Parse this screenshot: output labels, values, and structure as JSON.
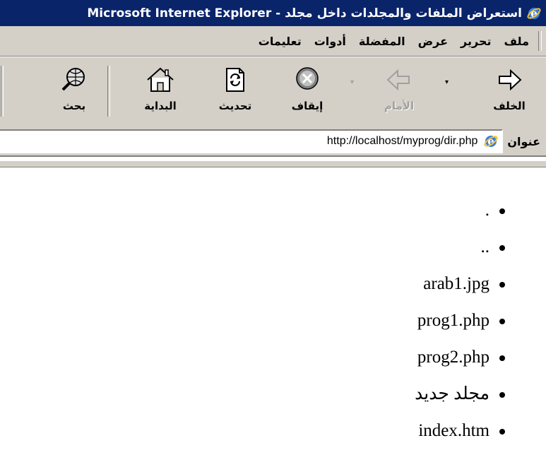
{
  "window": {
    "title": "Microsoft Internet Explorer - استعراض الملفات والمجلدات داخل مجلد"
  },
  "menu": {
    "items": [
      "ملف",
      "تحرير",
      "عرض",
      "المفضلة",
      "أدوات",
      "تعليمات"
    ]
  },
  "toolbar": {
    "back_label": "الخلف",
    "forward_label": "الأمام",
    "stop_label": "إيقاف",
    "refresh_label": "تحديث",
    "home_label": "البداية",
    "search_label": "بحث",
    "dropdown_glyph": "▾"
  },
  "address": {
    "label": "عنوان",
    "url": "http://localhost/myprog/dir.php"
  },
  "files": [
    ".",
    "..",
    "arab1.jpg",
    "prog1.php",
    "prog2.php",
    "مجلد جديد",
    "index.htm"
  ],
  "colors": {
    "titlebar": "#0a246a",
    "chrome": "#d4d0c8"
  }
}
